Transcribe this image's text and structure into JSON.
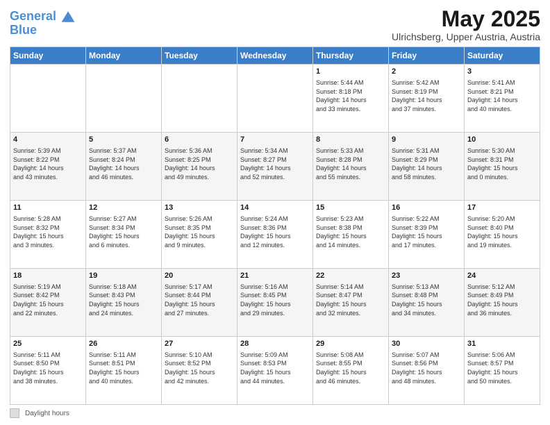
{
  "header": {
    "logo_line1": "General",
    "logo_line2": "Blue",
    "title": "May 2025",
    "subtitle": "Ulrichsberg, Upper Austria, Austria"
  },
  "weekdays": [
    "Sunday",
    "Monday",
    "Tuesday",
    "Wednesday",
    "Thursday",
    "Friday",
    "Saturday"
  ],
  "weeks": [
    [
      {
        "num": "",
        "info": ""
      },
      {
        "num": "",
        "info": ""
      },
      {
        "num": "",
        "info": ""
      },
      {
        "num": "",
        "info": ""
      },
      {
        "num": "1",
        "info": "Sunrise: 5:44 AM\nSunset: 8:18 PM\nDaylight: 14 hours\nand 33 minutes."
      },
      {
        "num": "2",
        "info": "Sunrise: 5:42 AM\nSunset: 8:19 PM\nDaylight: 14 hours\nand 37 minutes."
      },
      {
        "num": "3",
        "info": "Sunrise: 5:41 AM\nSunset: 8:21 PM\nDaylight: 14 hours\nand 40 minutes."
      }
    ],
    [
      {
        "num": "4",
        "info": "Sunrise: 5:39 AM\nSunset: 8:22 PM\nDaylight: 14 hours\nand 43 minutes."
      },
      {
        "num": "5",
        "info": "Sunrise: 5:37 AM\nSunset: 8:24 PM\nDaylight: 14 hours\nand 46 minutes."
      },
      {
        "num": "6",
        "info": "Sunrise: 5:36 AM\nSunset: 8:25 PM\nDaylight: 14 hours\nand 49 minutes."
      },
      {
        "num": "7",
        "info": "Sunrise: 5:34 AM\nSunset: 8:27 PM\nDaylight: 14 hours\nand 52 minutes."
      },
      {
        "num": "8",
        "info": "Sunrise: 5:33 AM\nSunset: 8:28 PM\nDaylight: 14 hours\nand 55 minutes."
      },
      {
        "num": "9",
        "info": "Sunrise: 5:31 AM\nSunset: 8:29 PM\nDaylight: 14 hours\nand 58 minutes."
      },
      {
        "num": "10",
        "info": "Sunrise: 5:30 AM\nSunset: 8:31 PM\nDaylight: 15 hours\nand 0 minutes."
      }
    ],
    [
      {
        "num": "11",
        "info": "Sunrise: 5:28 AM\nSunset: 8:32 PM\nDaylight: 15 hours\nand 3 minutes."
      },
      {
        "num": "12",
        "info": "Sunrise: 5:27 AM\nSunset: 8:34 PM\nDaylight: 15 hours\nand 6 minutes."
      },
      {
        "num": "13",
        "info": "Sunrise: 5:26 AM\nSunset: 8:35 PM\nDaylight: 15 hours\nand 9 minutes."
      },
      {
        "num": "14",
        "info": "Sunrise: 5:24 AM\nSunset: 8:36 PM\nDaylight: 15 hours\nand 12 minutes."
      },
      {
        "num": "15",
        "info": "Sunrise: 5:23 AM\nSunset: 8:38 PM\nDaylight: 15 hours\nand 14 minutes."
      },
      {
        "num": "16",
        "info": "Sunrise: 5:22 AM\nSunset: 8:39 PM\nDaylight: 15 hours\nand 17 minutes."
      },
      {
        "num": "17",
        "info": "Sunrise: 5:20 AM\nSunset: 8:40 PM\nDaylight: 15 hours\nand 19 minutes."
      }
    ],
    [
      {
        "num": "18",
        "info": "Sunrise: 5:19 AM\nSunset: 8:42 PM\nDaylight: 15 hours\nand 22 minutes."
      },
      {
        "num": "19",
        "info": "Sunrise: 5:18 AM\nSunset: 8:43 PM\nDaylight: 15 hours\nand 24 minutes."
      },
      {
        "num": "20",
        "info": "Sunrise: 5:17 AM\nSunset: 8:44 PM\nDaylight: 15 hours\nand 27 minutes."
      },
      {
        "num": "21",
        "info": "Sunrise: 5:16 AM\nSunset: 8:45 PM\nDaylight: 15 hours\nand 29 minutes."
      },
      {
        "num": "22",
        "info": "Sunrise: 5:14 AM\nSunset: 8:47 PM\nDaylight: 15 hours\nand 32 minutes."
      },
      {
        "num": "23",
        "info": "Sunrise: 5:13 AM\nSunset: 8:48 PM\nDaylight: 15 hours\nand 34 minutes."
      },
      {
        "num": "24",
        "info": "Sunrise: 5:12 AM\nSunset: 8:49 PM\nDaylight: 15 hours\nand 36 minutes."
      }
    ],
    [
      {
        "num": "25",
        "info": "Sunrise: 5:11 AM\nSunset: 8:50 PM\nDaylight: 15 hours\nand 38 minutes."
      },
      {
        "num": "26",
        "info": "Sunrise: 5:11 AM\nSunset: 8:51 PM\nDaylight: 15 hours\nand 40 minutes."
      },
      {
        "num": "27",
        "info": "Sunrise: 5:10 AM\nSunset: 8:52 PM\nDaylight: 15 hours\nand 42 minutes."
      },
      {
        "num": "28",
        "info": "Sunrise: 5:09 AM\nSunset: 8:53 PM\nDaylight: 15 hours\nand 44 minutes."
      },
      {
        "num": "29",
        "info": "Sunrise: 5:08 AM\nSunset: 8:55 PM\nDaylight: 15 hours\nand 46 minutes."
      },
      {
        "num": "30",
        "info": "Sunrise: 5:07 AM\nSunset: 8:56 PM\nDaylight: 15 hours\nand 48 minutes."
      },
      {
        "num": "31",
        "info": "Sunrise: 5:06 AM\nSunset: 8:57 PM\nDaylight: 15 hours\nand 50 minutes."
      }
    ]
  ],
  "footer": {
    "daylight_label": "Daylight hours"
  }
}
